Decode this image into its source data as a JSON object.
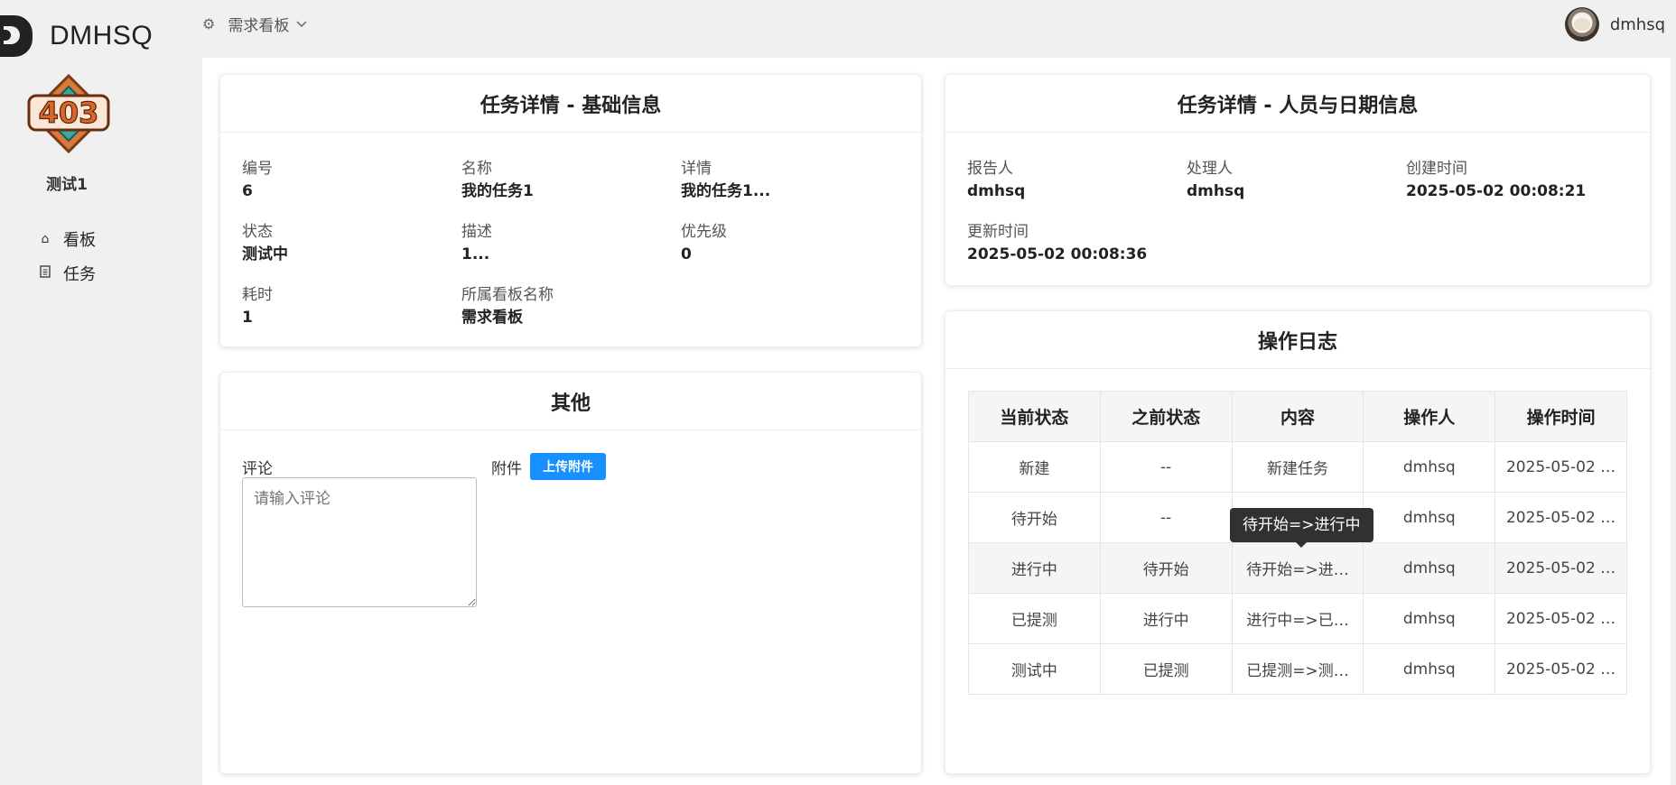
{
  "app": {
    "name": "DMHSQ"
  },
  "sidebar": {
    "badge_text": "403",
    "username": "测试1",
    "items": [
      {
        "label": "看板",
        "icon": "home-icon"
      },
      {
        "label": "任务",
        "icon": "document-icon"
      }
    ]
  },
  "header": {
    "board_selector": "需求看板",
    "user": "dmhsq"
  },
  "basic_info": {
    "title": "任务详情 - 基础信息",
    "fields": [
      {
        "label": "编号",
        "value": "6"
      },
      {
        "label": "名称",
        "value": "我的任务1"
      },
      {
        "label": "详情",
        "value": "我的任务1..."
      },
      {
        "label": "状态",
        "value": "测试中"
      },
      {
        "label": "描述",
        "value": "1..."
      },
      {
        "label": "优先级",
        "value": "0"
      },
      {
        "label": "耗时",
        "value": "1"
      },
      {
        "label": "所属看板名称",
        "value": "需求看板"
      }
    ]
  },
  "people_info": {
    "title": "任务详情 - 人员与日期信息",
    "fields": [
      {
        "label": "报告人",
        "value": "dmhsq"
      },
      {
        "label": "处理人",
        "value": "dmhsq"
      },
      {
        "label": "创建时间",
        "value": "2025-05-02 00:08:21"
      },
      {
        "label": "更新时间",
        "value": "2025-05-02 00:08:36"
      }
    ]
  },
  "other": {
    "title": "其他",
    "comment_label": "评论",
    "comment_placeholder": "请输入评论",
    "attach_label": "附件",
    "upload_label": "上传附件"
  },
  "log": {
    "title": "操作日志",
    "columns": [
      "当前状态",
      "之前状态",
      "内容",
      "操作人",
      "操作时间"
    ],
    "rows": [
      [
        "新建",
        "--",
        "新建任务",
        "dmhsq",
        "2025-05-02 …"
      ],
      [
        "待开始",
        "--",
        "",
        "dmhsq",
        "2025-05-02 …"
      ],
      [
        "进行中",
        "待开始",
        "待开始=>进…",
        "dmhsq",
        "2025-05-02 …"
      ],
      [
        "已提测",
        "进行中",
        "进行中=>已…",
        "dmhsq",
        "2025-05-02 …"
      ],
      [
        "测试中",
        "已提测",
        "已提测=>测…",
        "dmhsq",
        "2025-05-02 …"
      ]
    ],
    "tooltip": "待开始=>进行中"
  }
}
